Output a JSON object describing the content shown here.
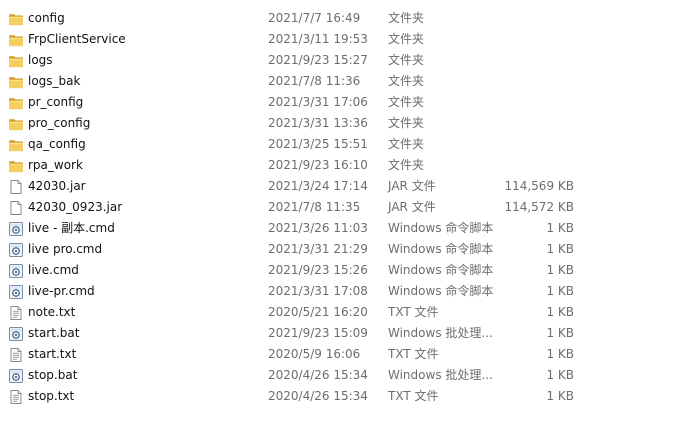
{
  "rows": [
    {
      "name": "config",
      "date": "2021/7/7 16:49",
      "type": "文件夹",
      "size": "",
      "icon": "folder-icon"
    },
    {
      "name": "FrpClientService",
      "date": "2021/3/11 19:53",
      "type": "文件夹",
      "size": "",
      "icon": "folder-icon"
    },
    {
      "name": "logs",
      "date": "2021/9/23 15:27",
      "type": "文件夹",
      "size": "",
      "icon": "folder-icon"
    },
    {
      "name": "logs_bak",
      "date": "2021/7/8 11:36",
      "type": "文件夹",
      "size": "",
      "icon": "folder-icon"
    },
    {
      "name": "pr_config",
      "date": "2021/3/31 17:06",
      "type": "文件夹",
      "size": "",
      "icon": "folder-icon"
    },
    {
      "name": "pro_config",
      "date": "2021/3/31 13:36",
      "type": "文件夹",
      "size": "",
      "icon": "folder-icon"
    },
    {
      "name": "qa_config",
      "date": "2021/3/25 15:51",
      "type": "文件夹",
      "size": "",
      "icon": "folder-icon"
    },
    {
      "name": "rpa_work",
      "date": "2021/9/23 16:10",
      "type": "文件夹",
      "size": "",
      "icon": "folder-icon"
    },
    {
      "name": "42030.jar",
      "date": "2021/3/24 17:14",
      "type": "JAR 文件",
      "size": "114,569 KB",
      "icon": "file-icon"
    },
    {
      "name": "42030_0923.jar",
      "date": "2021/7/8 11:35",
      "type": "JAR 文件",
      "size": "114,572 KB",
      "icon": "file-icon"
    },
    {
      "name": "live - 副本.cmd",
      "date": "2021/3/26 11:03",
      "type": "Windows 命令脚本",
      "size": "1 KB",
      "icon": "script-icon"
    },
    {
      "name": "live pro.cmd",
      "date": "2021/3/31 21:29",
      "type": "Windows 命令脚本",
      "size": "1 KB",
      "icon": "script-icon"
    },
    {
      "name": "live.cmd",
      "date": "2021/9/23 15:26",
      "type": "Windows 命令脚本",
      "size": "1 KB",
      "icon": "script-icon"
    },
    {
      "name": "live-pr.cmd",
      "date": "2021/3/31 17:08",
      "type": "Windows 命令脚本",
      "size": "1 KB",
      "icon": "script-icon"
    },
    {
      "name": "note.txt",
      "date": "2020/5/21 16:20",
      "type": "TXT 文件",
      "size": "1 KB",
      "icon": "text-file-icon"
    },
    {
      "name": "start.bat",
      "date": "2021/9/23 15:09",
      "type": "Windows 批处理...",
      "size": "1 KB",
      "icon": "script-icon"
    },
    {
      "name": "start.txt",
      "date": "2020/5/9 16:06",
      "type": "TXT 文件",
      "size": "1 KB",
      "icon": "text-file-icon"
    },
    {
      "name": "stop.bat",
      "date": "2020/4/26 15:34",
      "type": "Windows 批处理...",
      "size": "1 KB",
      "icon": "script-icon"
    },
    {
      "name": "stop.txt",
      "date": "2020/4/26 15:34",
      "type": "TXT 文件",
      "size": "1 KB",
      "icon": "text-file-icon"
    }
  ]
}
